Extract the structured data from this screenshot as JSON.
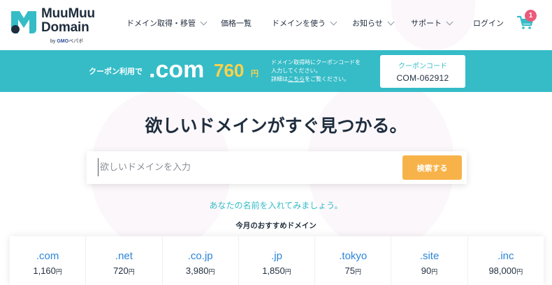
{
  "header": {
    "logo": {
      "line1": "MuuMuu",
      "line2": "Domain",
      "by": "by",
      "gmo": "GMO",
      "pepabo": "ペパボ"
    },
    "nav": [
      {
        "label": "ドメイン取得・移管",
        "has_dropdown": true
      },
      {
        "label": "価格一覧",
        "has_dropdown": false
      },
      {
        "label": "ドメインを使う",
        "has_dropdown": true
      },
      {
        "label": "お知らせ",
        "has_dropdown": true
      },
      {
        "label": "サポート",
        "has_dropdown": true
      },
      {
        "label": "ログイン",
        "has_dropdown": false
      }
    ],
    "cart_count": "1"
  },
  "banner": {
    "lead": "クーポン利用で",
    "tld": ".com",
    "price": "760",
    "yen": "円",
    "note_line1": "ドメイン取得時にクーポンコードを",
    "note_line2": "入力してください。",
    "note_line3_pre": "詳細は",
    "note_link": "こちら",
    "note_line3_post": "をご覧ください。",
    "coupon_label": "クーポンコード",
    "coupon_code": "COM-062912"
  },
  "hero": {
    "title": "欲しいドメインがすぐ見つかる。",
    "search_placeholder": "欲しいドメインを入力",
    "search_button": "検索する",
    "tagline": "あなたの名前を入れてみましょう。",
    "recommend_title": "今月のおすすめドメイン"
  },
  "domains": [
    {
      "tld": ".com",
      "price": "1,160",
      "yen": "円"
    },
    {
      "tld": ".net",
      "price": "720",
      "yen": "円"
    },
    {
      "tld": ".co.jp",
      "price": "3,980",
      "yen": "円"
    },
    {
      "tld": ".jp",
      "price": "1,850",
      "yen": "円"
    },
    {
      "tld": ".tokyo",
      "price": "75",
      "yen": "円"
    },
    {
      "tld": ".site",
      "price": "90",
      "yen": "円"
    },
    {
      "tld": ".inc",
      "price": "98,000",
      "yen": "円"
    }
  ],
  "colors": {
    "teal": "#35bcc7",
    "orange": "#f7b34a",
    "yellow": "#ffd24a",
    "badge": "#ec5a7b",
    "navy": "#1f2d3d",
    "link_blue": "#2a85d8"
  }
}
